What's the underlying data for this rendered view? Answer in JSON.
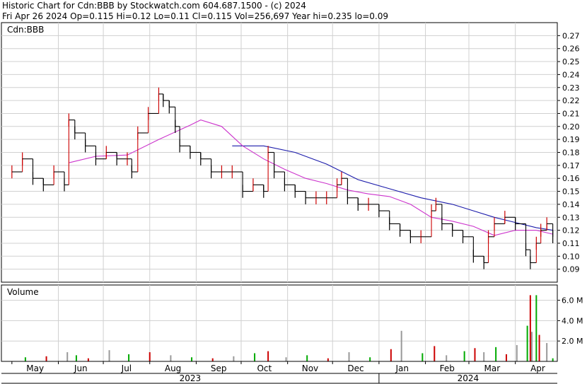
{
  "header": {
    "line1": "Historic Chart for Cdn:BBB by Stockwatch.com 604.687.1500 - (c) 2024",
    "line2": "Fri Apr 26 2024   Op=0.115   Hi=0.12   Lo=0.11   Cl=0.115   Vol=256,697   Year hi=0.235   lo=0.09"
  },
  "colors": {
    "up": "#cc0000",
    "down": "#000000",
    "ma_short": "#cc33cc",
    "ma_long": "#1a1aaa",
    "vol_up": "#00aa00",
    "vol_down": "#cc0000",
    "vol_neutral": "#999999",
    "grid": "#d0d0d0"
  },
  "chart_data": [
    {
      "type": "line",
      "title": "Cdn:BBB",
      "y_ticks": [
        "0.27",
        "0.26",
        "0.25",
        "0.24",
        "0.23",
        "0.22",
        "0.21",
        "0.20",
        "0.19",
        "0.18",
        "0.17",
        "0.16",
        "0.15",
        "0.14",
        "0.13",
        "0.12",
        "0.11",
        "0.10",
        "0.09"
      ],
      "ylim": [
        0.08,
        0.28
      ],
      "x_month_labels": [
        "May",
        "Jun",
        "Jul",
        "Aug",
        "Sep",
        "Oct",
        "Nov",
        "Dec",
        "Jan",
        "Feb",
        "Mar",
        "Apr"
      ],
      "x_year_labels": [
        "2023",
        "2024"
      ],
      "series": [
        {
          "points": [
            [
              "2023-05-01",
              0.165
            ],
            [
              "2023-05-08",
              0.175
            ],
            [
              "2023-05-15",
              0.16
            ],
            [
              "2023-05-22",
              0.155
            ],
            [
              "2023-05-29",
              0.165
            ],
            [
              "2023-06-05",
              0.155
            ],
            [
              "2023-06-08",
              0.205
            ],
            [
              "2023-06-12",
              0.195
            ],
            [
              "2023-06-19",
              0.185
            ],
            [
              "2023-06-26",
              0.175
            ],
            [
              "2023-07-03",
              0.18
            ],
            [
              "2023-07-10",
              0.175
            ],
            [
              "2023-07-17",
              0.175
            ],
            [
              "2023-07-20",
              0.165
            ],
            [
              "2023-07-24",
              0.195
            ],
            [
              "2023-07-31",
              0.21
            ],
            [
              "2023-08-07",
              0.225
            ],
            [
              "2023-08-10",
              0.22
            ],
            [
              "2023-08-14",
              0.215
            ],
            [
              "2023-08-18",
              0.2
            ],
            [
              "2023-08-21",
              0.185
            ],
            [
              "2023-08-28",
              0.18
            ],
            [
              "2023-09-04",
              0.175
            ],
            [
              "2023-09-11",
              0.165
            ],
            [
              "2023-09-18",
              0.165
            ],
            [
              "2023-09-25",
              0.165
            ],
            [
              "2023-10-02",
              0.15
            ],
            [
              "2023-10-09",
              0.155
            ],
            [
              "2023-10-16",
              0.15
            ],
            [
              "2023-10-19",
              0.18
            ],
            [
              "2023-10-23",
              0.165
            ],
            [
              "2023-10-30",
              0.155
            ],
            [
              "2023-11-06",
              0.15
            ],
            [
              "2023-11-13",
              0.145
            ],
            [
              "2023-11-20",
              0.145
            ],
            [
              "2023-11-27",
              0.145
            ],
            [
              "2023-12-04",
              0.155
            ],
            [
              "2023-12-07",
              0.16
            ],
            [
              "2023-12-11",
              0.145
            ],
            [
              "2023-12-18",
              0.14
            ],
            [
              "2023-12-25",
              0.14
            ],
            [
              "2024-01-01",
              0.135
            ],
            [
              "2024-01-08",
              0.125
            ],
            [
              "2024-01-15",
              0.12
            ],
            [
              "2024-01-22",
              0.115
            ],
            [
              "2024-01-29",
              0.115
            ],
            [
              "2024-02-05",
              0.135
            ],
            [
              "2024-02-08",
              0.14
            ],
            [
              "2024-02-12",
              0.125
            ],
            [
              "2024-02-19",
              0.12
            ],
            [
              "2024-02-26",
              0.115
            ],
            [
              "2024-03-04",
              0.1
            ],
            [
              "2024-03-11",
              0.095
            ],
            [
              "2024-03-14",
              0.115
            ],
            [
              "2024-03-18",
              0.125
            ],
            [
              "2024-03-25",
              0.13
            ],
            [
              "2024-04-01",
              0.125
            ],
            [
              "2024-04-08",
              0.105
            ],
            [
              "2024-04-11",
              0.095
            ],
            [
              "2024-04-15",
              0.11
            ],
            [
              "2024-04-18",
              0.12
            ],
            [
              "2024-04-22",
              0.125
            ],
            [
              "2024-04-26",
              0.115
            ]
          ]
        },
        {
          "points": [
            [
              "2023-06-08",
              0.172
            ],
            [
              "2023-06-26",
              0.177
            ],
            [
              "2023-07-17",
              0.178
            ],
            [
              "2023-08-07",
              0.19
            ],
            [
              "2023-08-28",
              0.201
            ],
            [
              "2023-09-04",
              0.205
            ],
            [
              "2023-09-18",
              0.2
            ],
            [
              "2023-10-02",
              0.185
            ],
            [
              "2023-10-16",
              0.175
            ],
            [
              "2023-10-30",
              0.167
            ],
            [
              "2023-11-13",
              0.16
            ],
            [
              "2023-11-27",
              0.156
            ],
            [
              "2023-12-11",
              0.151
            ],
            [
              "2023-12-25",
              0.148
            ],
            [
              "2024-01-08",
              0.146
            ],
            [
              "2024-01-22",
              0.14
            ],
            [
              "2024-02-05",
              0.13
            ],
            [
              "2024-02-19",
              0.127
            ],
            [
              "2024-03-04",
              0.123
            ],
            [
              "2024-03-18",
              0.116
            ],
            [
              "2024-04-01",
              0.12
            ],
            [
              "2024-04-15",
              0.12
            ],
            [
              "2024-04-26",
              0.117
            ]
          ]
        },
        {
          "points": [
            [
              "2023-09-25",
              0.185
            ],
            [
              "2023-10-16",
              0.185
            ],
            [
              "2023-11-06",
              0.18
            ],
            [
              "2023-11-27",
              0.171
            ],
            [
              "2023-12-18",
              0.159
            ],
            [
              "2024-01-08",
              0.152
            ],
            [
              "2024-01-29",
              0.145
            ],
            [
              "2024-02-19",
              0.14
            ],
            [
              "2024-03-04",
              0.135
            ],
            [
              "2024-03-18",
              0.13
            ],
            [
              "2024-04-01",
              0.126
            ],
            [
              "2024-04-15",
              0.122
            ],
            [
              "2024-04-26",
              0.12
            ]
          ]
        }
      ]
    },
    {
      "type": "bar",
      "title": "Volume",
      "y_ticks": [
        "6.0 M",
        "4.0 M",
        "2.0 M"
      ],
      "ylim": [
        0,
        7.5
      ],
      "bars": [
        [
          "2023-05-10",
          0.4
        ],
        [
          "2023-05-24",
          0.5
        ],
        [
          "2023-06-07",
          0.9
        ],
        [
          "2023-06-13",
          0.6
        ],
        [
          "2023-06-21",
          0.3
        ],
        [
          "2023-07-05",
          1.1
        ],
        [
          "2023-07-18",
          0.7
        ],
        [
          "2023-08-01",
          0.9
        ],
        [
          "2023-08-15",
          0.6
        ],
        [
          "2023-08-29",
          0.4
        ],
        [
          "2023-09-12",
          0.3
        ],
        [
          "2023-09-26",
          0.5
        ],
        [
          "2023-10-10",
          0.8
        ],
        [
          "2023-10-19",
          1.0
        ],
        [
          "2023-10-31",
          0.4
        ],
        [
          "2023-11-14",
          0.6
        ],
        [
          "2023-11-28",
          0.3
        ],
        [
          "2023-12-12",
          0.9
        ],
        [
          "2023-12-26",
          0.4
        ],
        [
          "2024-01-09",
          1.2
        ],
        [
          "2024-01-16",
          3.0
        ],
        [
          "2024-01-30",
          0.8
        ],
        [
          "2024-02-07",
          1.5
        ],
        [
          "2024-02-15",
          0.6
        ],
        [
          "2024-02-27",
          1.0
        ],
        [
          "2024-03-05",
          1.3
        ],
        [
          "2024-03-11",
          0.9
        ],
        [
          "2024-03-19",
          1.4
        ],
        [
          "2024-03-26",
          0.7
        ],
        [
          "2024-04-02",
          1.6
        ],
        [
          "2024-04-09",
          3.5
        ],
        [
          "2024-04-11",
          6.5
        ],
        [
          "2024-04-12",
          2.9
        ],
        [
          "2024-04-15",
          6.5
        ],
        [
          "2024-04-17",
          2.6
        ],
        [
          "2024-04-22",
          1.8
        ],
        [
          "2024-04-26",
          0.3
        ]
      ]
    }
  ]
}
